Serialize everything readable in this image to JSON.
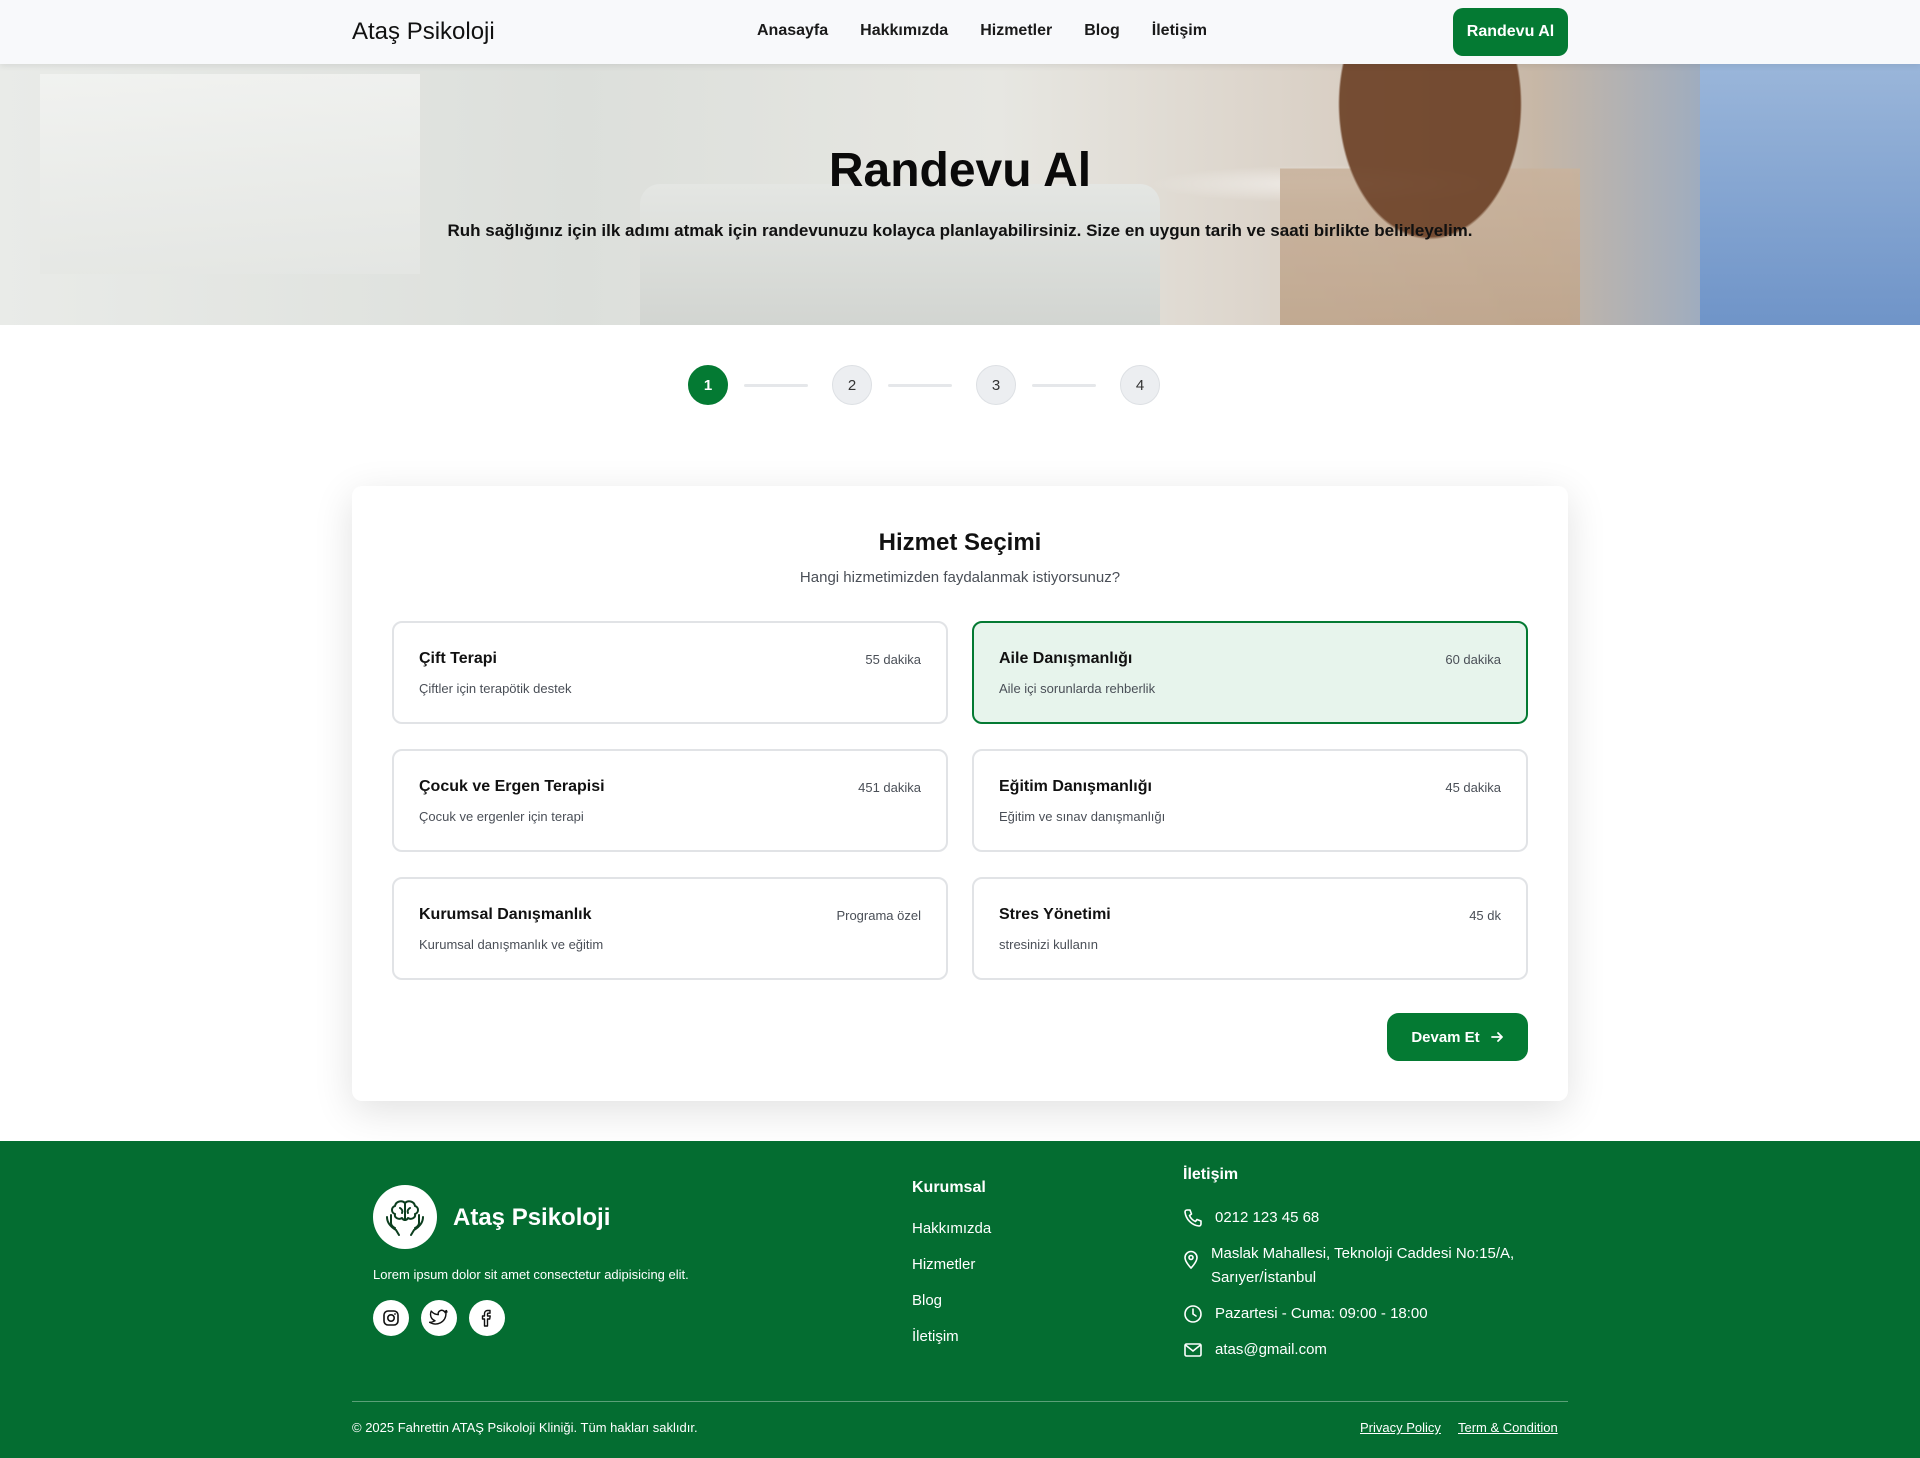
{
  "header": {
    "brand": "Ataş Psikoloji",
    "nav": [
      "Anasayfa",
      "Hakkımızda",
      "Hizmetler",
      "Blog",
      "İletişim"
    ],
    "cta": "Randevu Al"
  },
  "hero": {
    "title": "Randevu Al",
    "subtitle": "Ruh sağlığınız için ilk adımı atmak için randevunuzu kolayca planlayabilirsiniz. Size en uygun tarih ve saati birlikte belirleyelim."
  },
  "stepper": {
    "steps": [
      "1",
      "2",
      "3",
      "4"
    ],
    "current": 1
  },
  "service_selection": {
    "title": "Hizmet Seçimi",
    "subtitle": "Hangi hizmetimizden faydalanmak istiyorsunuz?",
    "services": [
      {
        "name": "Çift Terapi",
        "duration": "55 dakika",
        "description": "Çiftler için terapötik destek",
        "selected": false
      },
      {
        "name": "Aile Danışmanlığı",
        "duration": "60 dakika",
        "description": "Aile içi sorunlarda rehberlik",
        "selected": true
      },
      {
        "name": "Çocuk ve Ergen Terapisi",
        "duration": "451 dakika",
        "description": "Çocuk ve ergenler için terapi",
        "selected": false
      },
      {
        "name": "Eğitim Danışmanlığı",
        "duration": "45 dakika",
        "description": "Eğitim ve sınav danışmanlığı",
        "selected": false
      },
      {
        "name": "Kurumsal Danışmanlık",
        "duration": "Programa özel",
        "description": "Kurumsal danışmanlık ve eğitim",
        "selected": false
      },
      {
        "name": "Stres Yönetimi",
        "duration": "45 dk",
        "description": "stresinizi kullanın",
        "selected": false
      }
    ],
    "next_label": "Devam Et"
  },
  "footer": {
    "brand": "Ataş Psikoloji",
    "description": "Lorem ipsum dolor sit amet consectetur adipisicing elit.",
    "social_icons": [
      "instagram-icon",
      "twitter-icon",
      "facebook-icon"
    ],
    "corporate_title": "Kurumsal",
    "corporate_links": [
      "Hakkımızda",
      "Hizmetler",
      "Blog",
      "İletişim"
    ],
    "contact_title": "İletişim",
    "phone": "0212 123 45 68",
    "address_line1": "Maslak Mahallesi, Teknoloji Caddesi No:15/A,",
    "address_line2": "Sarıyer/İstanbul",
    "hours": "Pazartesi - Cuma: 09:00 - 18:00",
    "email": "atas@gmail.com",
    "copyright": "© 2025 Fahrettin ATAŞ Psikoloji Kliniği. Tüm hakları saklıdır.",
    "privacy": "Privacy Policy",
    "terms": "Term & Condition"
  },
  "colors": {
    "primary": "#047a33",
    "footer_bg": "#046d31",
    "selected_bg": "#e7f4ec"
  }
}
